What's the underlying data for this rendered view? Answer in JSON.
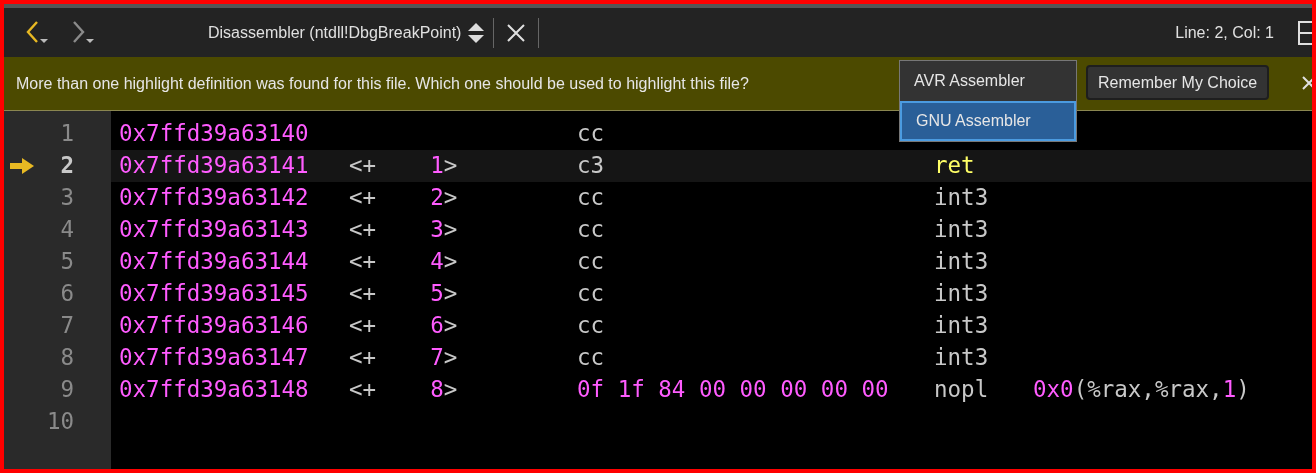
{
  "toolbar": {
    "back": {
      "disabled": false
    },
    "forward": {
      "disabled": true
    },
    "title": "Disassembler (ntdll!DbgBreakPoint)",
    "status": "Line: 2, Col: 1"
  },
  "infobar": {
    "message": "More than one highlight definition was found for this file. Which one should be used to highlight this file?",
    "options": [
      {
        "label": "AVR Assembler",
        "selected": false
      },
      {
        "label": "GNU Assembler",
        "selected": true
      }
    ],
    "button": "Remember My Choice"
  },
  "lines": [
    {
      "number": "1",
      "current": false,
      "address": "0x7ffd39a63140",
      "bytes": [
        {
          "text": "cc",
          "kind": "plain"
        }
      ]
    },
    {
      "number": "2",
      "current": true,
      "address": "0x7ffd39a63141",
      "offset": [
        {
          "text": "<+",
          "kind": "plain"
        },
        {
          "text": "1",
          "kind": "number"
        },
        {
          "text": ">",
          "kind": "plain"
        }
      ],
      "bytes": [
        {
          "text": "c3",
          "kind": "plain"
        }
      ],
      "mnemonic": {
        "text": "ret",
        "kind": "keyword"
      }
    },
    {
      "number": "3",
      "current": false,
      "address": "0x7ffd39a63142",
      "offset": [
        {
          "text": "<+",
          "kind": "plain"
        },
        {
          "text": "2",
          "kind": "number"
        },
        {
          "text": ">",
          "kind": "plain"
        }
      ],
      "bytes": [
        {
          "text": "cc",
          "kind": "plain"
        }
      ],
      "mnemonic": {
        "text": "int3",
        "kind": "plain"
      }
    },
    {
      "number": "4",
      "current": false,
      "address": "0x7ffd39a63143",
      "offset": [
        {
          "text": "<+",
          "kind": "plain"
        },
        {
          "text": "3",
          "kind": "number"
        },
        {
          "text": ">",
          "kind": "plain"
        }
      ],
      "bytes": [
        {
          "text": "cc",
          "kind": "plain"
        }
      ],
      "mnemonic": {
        "text": "int3",
        "kind": "plain"
      }
    },
    {
      "number": "5",
      "current": false,
      "address": "0x7ffd39a63144",
      "offset": [
        {
          "text": "<+",
          "kind": "plain"
        },
        {
          "text": "4",
          "kind": "number"
        },
        {
          "text": ">",
          "kind": "plain"
        }
      ],
      "bytes": [
        {
          "text": "cc",
          "kind": "plain"
        }
      ],
      "mnemonic": {
        "text": "int3",
        "kind": "plain"
      }
    },
    {
      "number": "6",
      "current": false,
      "address": "0x7ffd39a63145",
      "offset": [
        {
          "text": "<+",
          "kind": "plain"
        },
        {
          "text": "5",
          "kind": "number"
        },
        {
          "text": ">",
          "kind": "plain"
        }
      ],
      "bytes": [
        {
          "text": "cc",
          "kind": "plain"
        }
      ],
      "mnemonic": {
        "text": "int3",
        "kind": "plain"
      }
    },
    {
      "number": "7",
      "current": false,
      "address": "0x7ffd39a63146",
      "offset": [
        {
          "text": "<+",
          "kind": "plain"
        },
        {
          "text": "6",
          "kind": "number"
        },
        {
          "text": ">",
          "kind": "plain"
        }
      ],
      "bytes": [
        {
          "text": "cc",
          "kind": "plain"
        }
      ],
      "mnemonic": {
        "text": "int3",
        "kind": "plain"
      }
    },
    {
      "number": "8",
      "current": false,
      "address": "0x7ffd39a63147",
      "offset": [
        {
          "text": "<+",
          "kind": "plain"
        },
        {
          "text": "7",
          "kind": "number"
        },
        {
          "text": ">",
          "kind": "plain"
        }
      ],
      "bytes": [
        {
          "text": "cc",
          "kind": "plain"
        }
      ],
      "mnemonic": {
        "text": "int3",
        "kind": "plain"
      }
    },
    {
      "number": "9",
      "current": false,
      "address": "0x7ffd39a63148",
      "offset": [
        {
          "text": "<+",
          "kind": "plain"
        },
        {
          "text": "8",
          "kind": "number"
        },
        {
          "text": ">",
          "kind": "plain"
        }
      ],
      "bytes": [
        {
          "text": "0f 1f 84 00 00 00 00 00",
          "kind": "number"
        }
      ],
      "mnemonic": {
        "text": "nopl",
        "kind": "plain"
      },
      "operands": [
        {
          "text": "0x0",
          "kind": "number"
        },
        {
          "text": "(%rax,%rax,",
          "kind": "plain"
        },
        {
          "text": "1",
          "kind": "number"
        },
        {
          "text": ")",
          "kind": "plain"
        }
      ]
    },
    {
      "number": "10",
      "current": false
    }
  ]
}
